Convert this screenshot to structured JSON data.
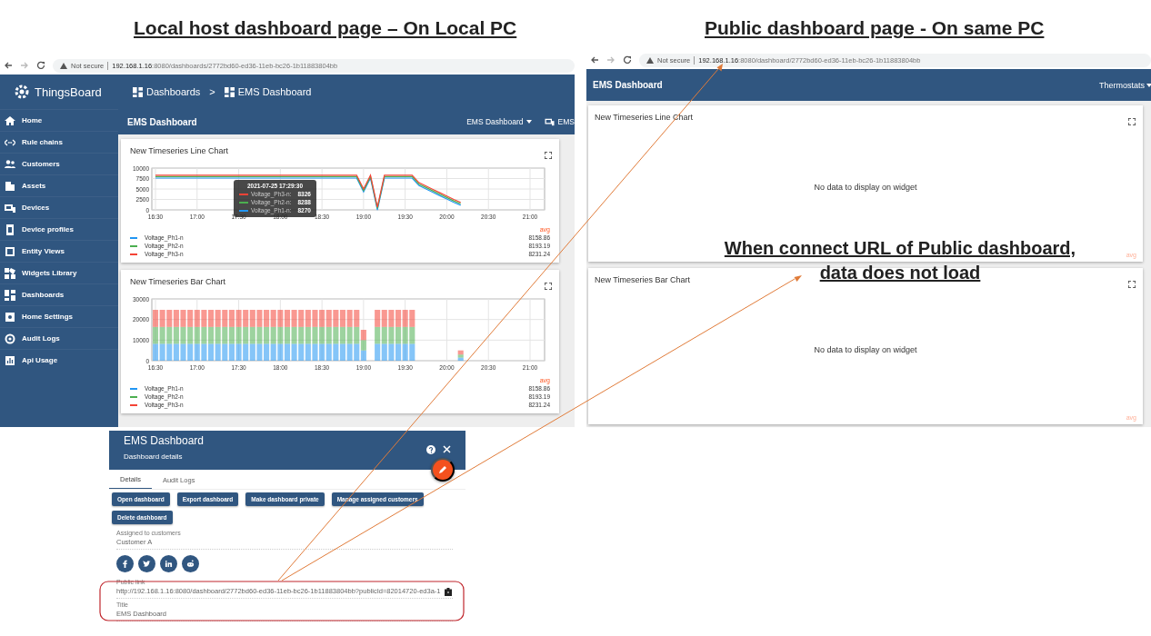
{
  "annotations": {
    "left_heading": "Local host dashboard page – On Local PC",
    "right_heading": "Public dashboard page - On same PC",
    "callout": [
      "When connect URL of Public dashboard,",
      "data does not load"
    ]
  },
  "local_page": {
    "browser": {
      "security": "Not secure",
      "url_host": "192.168.1.16",
      "url_rest": ":8080/dashboards/2772bd60-ed36-11eb-bc26-1b11883804bb"
    },
    "logo": "ThingsBoard",
    "breadcrumbs": [
      "Dashboards",
      "EMS Dashboard"
    ],
    "breadcrumb_separator": ">",
    "sidebar": {
      "items": [
        {
          "label": "Home"
        },
        {
          "label": "Rule chains"
        },
        {
          "label": "Customers"
        },
        {
          "label": "Assets"
        },
        {
          "label": "Devices"
        },
        {
          "label": "Device profiles"
        },
        {
          "label": "Entity Views"
        },
        {
          "label": "Widgets Library"
        },
        {
          "label": "Dashboards"
        },
        {
          "label": "Home Settings"
        },
        {
          "label": "Audit Logs"
        },
        {
          "label": "Api Usage"
        }
      ]
    },
    "toolbar": {
      "title": "EMS Dashboard",
      "dashboard_select": "EMS Dashboard",
      "entity_button": "EMS"
    },
    "widgets": [
      {
        "title": "New Timeseries Line Chart",
        "chart_data": {
          "type": "line",
          "grid": true,
          "categories": [
            "16:30",
            null,
            null,
            null,
            null,
            null,
            "17:00",
            null,
            null,
            null,
            null,
            null,
            "17:30",
            null,
            null,
            null,
            null,
            null,
            "18:00",
            null,
            null,
            null,
            null,
            null,
            "18:30",
            null,
            null,
            null,
            null,
            null,
            "19:00",
            null,
            null,
            null,
            null,
            null,
            "19:30",
            null,
            null,
            null,
            null,
            null,
            "20:00",
            null,
            null,
            null,
            null,
            null,
            "20:30",
            null,
            null,
            null,
            null,
            null,
            "21:00"
          ],
          "ylim": [
            0,
            10000
          ],
          "yticks": [
            0,
            2500,
            5000,
            7500,
            10000
          ],
          "series": [
            {
              "name": "Voltage_Ph1-n",
              "color": "#2196f3",
              "values": [
                7600,
                7600,
                7600,
                7600,
                7600,
                7600,
                7600,
                7600,
                7600,
                7600,
                7600,
                7600,
                7600,
                7600,
                7600,
                7600,
                7600,
                7600,
                7600,
                7600,
                7600,
                7600,
                7600,
                7600,
                7600,
                7600,
                7600,
                7600,
                7600,
                7600,
                4300,
                7600,
                0,
                7600,
                7600,
                7600,
                7600,
                7600,
                5800,
                5000,
                4200,
                3400,
                2600,
                1800,
                1100,
                null,
                null,
                null,
                null,
                null,
                null,
                null,
                null,
                null,
                null
              ]
            },
            {
              "name": "Voltage_Ph2-n",
              "color": "#4caf50",
              "values": [
                7950,
                7950,
                7950,
                7950,
                7950,
                7950,
                7950,
                7950,
                7950,
                7950,
                7950,
                7950,
                7950,
                7950,
                7950,
                7950,
                7950,
                7950,
                7950,
                7950,
                7950,
                7950,
                7950,
                7950,
                7950,
                7950,
                7950,
                7950,
                7950,
                7950,
                4650,
                7950,
                350,
                7950,
                7950,
                7950,
                7950,
                7950,
                6150,
                5350,
                4550,
                3750,
                2950,
                2150,
                1450,
                null,
                null,
                null,
                null,
                null,
                null,
                null,
                null,
                null,
                null
              ]
            },
            {
              "name": "Voltage_Ph3-n",
              "color": "#f44336",
              "values": [
                8300,
                8300,
                8300,
                8300,
                8300,
                8300,
                8300,
                8300,
                8300,
                8300,
                8300,
                8300,
                8300,
                8300,
                8300,
                8300,
                8300,
                8300,
                8300,
                8300,
                8300,
                8300,
                8300,
                8300,
                8300,
                8300,
                8300,
                8300,
                8300,
                8300,
                5000,
                8300,
                700,
                8300,
                8300,
                8300,
                8300,
                8300,
                6500,
                5700,
                4900,
                4100,
                3300,
                2500,
                1800,
                null,
                null,
                null,
                null,
                null,
                null,
                null,
                null,
                null,
                null
              ]
            }
          ]
        },
        "tooltip": {
          "time": "2021-07-25 17:29:30",
          "rows": [
            {
              "name": "Voltage_Ph3-n:",
              "value": "8326",
              "color": "#f44336"
            },
            {
              "name": "Voltage_Ph2-n:",
              "value": "8288",
              "color": "#4caf50"
            },
            {
              "name": "Voltage_Ph1-n:",
              "value": "8270",
              "color": "#2196f3"
            }
          ]
        },
        "legend": {
          "header": "avg",
          "values": [
            "8158.86",
            "8193.19",
            "8231.24"
          ]
        }
      },
      {
        "title": "New Timeseries Bar Chart",
        "chart_data": {
          "type": "bar",
          "grid": true,
          "stacked": true,
          "categories": [
            "16:30",
            null,
            null,
            null,
            null,
            null,
            "17:00",
            null,
            null,
            null,
            null,
            null,
            "17:30",
            null,
            null,
            null,
            null,
            null,
            "18:00",
            null,
            null,
            null,
            null,
            null,
            "18:30",
            null,
            null,
            null,
            null,
            null,
            "19:00",
            null,
            null,
            null,
            null,
            null,
            "19:30",
            null,
            null,
            null,
            null,
            null,
            "20:00",
            null,
            null,
            null,
            null,
            null,
            "20:30",
            null,
            null,
            null,
            null,
            null,
            "21:00"
          ],
          "ylim": [
            0,
            30000
          ],
          "yticks": [
            0,
            10000,
            20000,
            30000
          ],
          "series": [
            {
              "name": "Voltage_Ph1-n",
              "color": "#2196f3",
              "values": [
                8200,
                8200,
                8200,
                8200,
                8200,
                8200,
                8200,
                8200,
                8200,
                8200,
                8200,
                8200,
                8200,
                8200,
                8200,
                8200,
                8200,
                8200,
                8200,
                8200,
                8200,
                8200,
                8200,
                8200,
                8200,
                8200,
                8200,
                8200,
                8200,
                8200,
                5000,
                null,
                8200,
                8200,
                8200,
                8200,
                8200,
                8200,
                null,
                null,
                null,
                null,
                null,
                null,
                1500,
                null,
                null,
                null,
                null,
                null,
                null,
                null,
                null,
                null,
                null
              ]
            },
            {
              "name": "Voltage_Ph2-n",
              "color": "#4caf50",
              "values": [
                8200,
                8200,
                8200,
                8200,
                8200,
                8200,
                8200,
                8200,
                8200,
                8200,
                8200,
                8200,
                8200,
                8200,
                8200,
                8200,
                8200,
                8200,
                8200,
                8200,
                8200,
                8200,
                8200,
                8200,
                8200,
                8200,
                8200,
                8200,
                8200,
                8200,
                5000,
                null,
                8200,
                8200,
                8200,
                8200,
                8200,
                8200,
                null,
                null,
                null,
                null,
                null,
                null,
                1500,
                null,
                null,
                null,
                null,
                null,
                null,
                null,
                null,
                null,
                null
              ]
            },
            {
              "name": "Voltage_Ph3-n",
              "color": "#f44336",
              "values": [
                8300,
                8300,
                8300,
                8300,
                8300,
                8300,
                8300,
                8300,
                8300,
                8300,
                8300,
                8300,
                8300,
                8300,
                8300,
                8300,
                8300,
                8300,
                8300,
                8300,
                8300,
                8300,
                8300,
                8300,
                8300,
                8300,
                8300,
                8300,
                8300,
                8300,
                5000,
                null,
                8300,
                8300,
                8300,
                8300,
                8300,
                8300,
                null,
                null,
                null,
                null,
                null,
                null,
                2000,
                null,
                null,
                null,
                null,
                null,
                null,
                null,
                null,
                null,
                null
              ]
            }
          ]
        },
        "legend": {
          "header": "avg",
          "values": [
            "8158.86",
            "8193.19",
            "8231.24"
          ]
        }
      }
    ]
  },
  "public_page": {
    "browser": {
      "security": "Not secure",
      "url_host": "192.168.1.16",
      "url_rest": ":8080/dashboard/2772bd60-ed36-11eb-bc26-1b11883804bb"
    },
    "title": "EMS Dashboard",
    "state_select": "Thermostats",
    "widgets": [
      {
        "title": "New Timeseries Line Chart",
        "message": "No data to display on widget",
        "legend_header": "avg"
      },
      {
        "title": "New Timeseries Bar Chart",
        "message": "No data to display on widget",
        "legend_header": "avg"
      }
    ]
  },
  "details_panel": {
    "title": "EMS Dashboard",
    "subtitle": "Dashboard details",
    "tabs": [
      {
        "label": "Details",
        "selected": true
      },
      {
        "label": "Audit Logs",
        "selected": false
      }
    ],
    "buttons": [
      "Open dashboard",
      "Export dashboard",
      "Make dashboard private",
      "Manage assigned customers",
      "Delete dashboard"
    ],
    "assigned": {
      "label": "Assigned to customers",
      "value": "Customer A"
    },
    "public_link": {
      "label": "Public link",
      "value": "http://192.168.1.16:8080/dashboard/2772bd60-ed36-11eb-bc26-1b11883804bb?publicId=82014720-ed3a-1"
    },
    "title_field": {
      "label": "Title",
      "value": "EMS Dashboard"
    }
  }
}
